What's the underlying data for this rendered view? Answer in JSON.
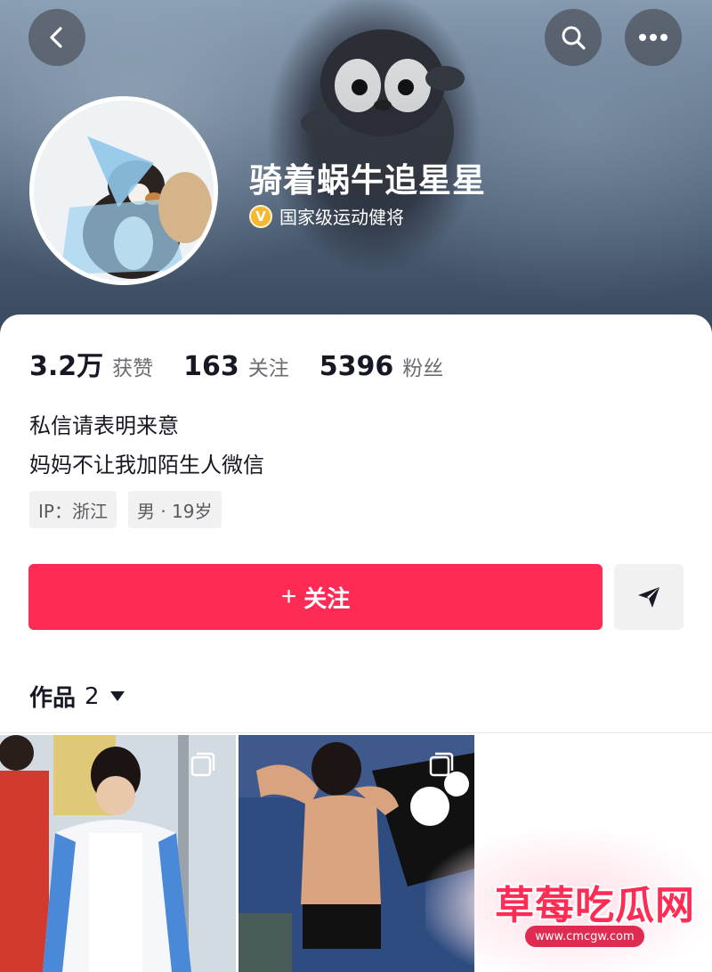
{
  "header": {
    "back_icon": "chevron-left-icon",
    "search_icon": "search-icon",
    "more_icon": "more-horizontal-icon"
  },
  "profile": {
    "username": "骑着蜗牛追星星",
    "verify_badge": "V",
    "verify_text": "国家级运动健将"
  },
  "stats": [
    {
      "value": "3.2万",
      "label": "获赞"
    },
    {
      "value": "163",
      "label": "关注"
    },
    {
      "value": "5396",
      "label": "粉丝"
    }
  ],
  "bio": {
    "line1": "私信请表明来意",
    "line2": "妈妈不让我加陌生人微信"
  },
  "tags": {
    "ip": "IP：浙江",
    "gender_age": "男 · 19岁"
  },
  "actions": {
    "follow_plus": "+",
    "follow_label": "关注",
    "message_icon": "send-icon"
  },
  "works": {
    "label": "作品",
    "count": "2"
  },
  "watermark": {
    "title": "草莓吃瓜网",
    "url": "www.cmcgw.com"
  },
  "colors": {
    "accent": "#fe2c55",
    "text_primary": "#161823",
    "text_secondary": "#6b6d75",
    "tag_bg": "#f1f1f2"
  }
}
